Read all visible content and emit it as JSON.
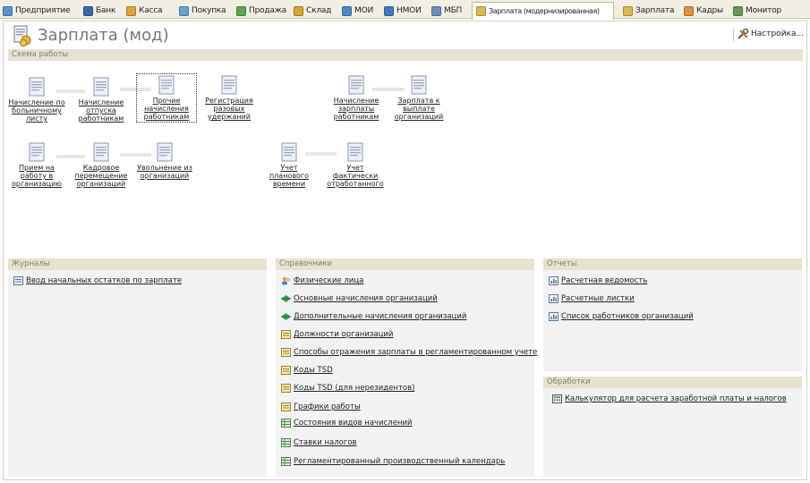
{
  "tabs": [
    {
      "label": "Предприятие",
      "icon": "enterprise-icon",
      "color": "#5a8fd8"
    },
    {
      "label": "Банк",
      "icon": "bank-icon",
      "color": "#3a66b0"
    },
    {
      "label": "Касса",
      "icon": "cash-icon",
      "color": "#e0a43a"
    },
    {
      "label": "Покупка",
      "icon": "purchase-icon",
      "color": "#6aa0d0"
    },
    {
      "label": "Продажа",
      "icon": "sale-icon",
      "color": "#5fa64d"
    },
    {
      "label": "Склад",
      "icon": "warehouse-icon",
      "color": "#d6a532"
    },
    {
      "label": "МОИ",
      "icon": "moi-icon",
      "color": "#4f86c8"
    },
    {
      "label": "НМОИ",
      "icon": "nmoi-icon",
      "color": "#3f78c0"
    },
    {
      "label": "МБП",
      "icon": "mbp-icon",
      "color": "#6c8fb6"
    },
    {
      "label": "Зарплата (модернизированная)",
      "icon": "salary-mod-icon",
      "color": "#d9b850"
    },
    {
      "label": "Зарплата",
      "icon": "salary-icon",
      "color": "#d9b850"
    },
    {
      "label": "Кадры",
      "icon": "hr-icon",
      "color": "#e09040"
    },
    {
      "label": "Монитор",
      "icon": "monitor-icon",
      "color": "#6a9a4a"
    }
  ],
  "page": {
    "title": "Зарплата (мод)",
    "settings_label": "Настройка..."
  },
  "schema": {
    "heading": "Схема работы",
    "nodes": [
      {
        "label": "Начисление по больничному листу"
      },
      {
        "label": "Начисление отпуска работникам"
      },
      {
        "label": "Прочие начисления работникам"
      },
      {
        "label": "Регистрация разовых удержаний"
      },
      {
        "label": "Начисление зарплаты работникам"
      },
      {
        "label": "Зарплата к выплате организаций"
      },
      {
        "label": "Прием на работу в организацию"
      },
      {
        "label": "Кадровое перемещение организаций"
      },
      {
        "label": "Увольнение из организаций"
      },
      {
        "label": "Учет планового времени"
      },
      {
        "label": "Учет фактически отработанного"
      }
    ]
  },
  "journals": {
    "heading": "Журналы",
    "items": [
      {
        "label": "Ввод начальных остатков по зарплате",
        "icon": "journal-icon"
      }
    ]
  },
  "references": {
    "heading": "Справочники",
    "items": [
      {
        "label": "Физические лица",
        "icon": "persons-icon"
      },
      {
        "label": "Основные начисления организаций",
        "icon": "accrual-icon"
      },
      {
        "label": "Дополнительные начисления организаций",
        "icon": "accrual-icon"
      },
      {
        "label": "Должности организаций",
        "icon": "catalog-icon"
      },
      {
        "label": "Способы отражения зарплаты в регламентированном учете",
        "icon": "catalog-icon"
      },
      {
        "label": "Коды TSD",
        "icon": "catalog-icon"
      },
      {
        "label": "Коды TSD (для нерезидентов)",
        "icon": "catalog-icon"
      },
      {
        "label": "Графики работы",
        "icon": "catalog-icon"
      },
      {
        "label": "Состояния видов начислений",
        "icon": "register-icon"
      },
      {
        "label": "Ставки налогов",
        "icon": "register-icon"
      },
      {
        "label": "Регламентированный производственный календарь",
        "icon": "register-icon"
      }
    ]
  },
  "reports": {
    "heading": "Отчеты",
    "items": [
      {
        "label": "Расчетная ведомость",
        "icon": "report-icon"
      },
      {
        "label": "Расчетные листки",
        "icon": "report-icon"
      },
      {
        "label": "Список работников организаций",
        "icon": "report-icon"
      }
    ]
  },
  "processing": {
    "heading": "Обработки",
    "items": [
      {
        "label": "Калькулятор для расчета заработной платы и налогов",
        "icon": "calculator-icon"
      }
    ]
  }
}
